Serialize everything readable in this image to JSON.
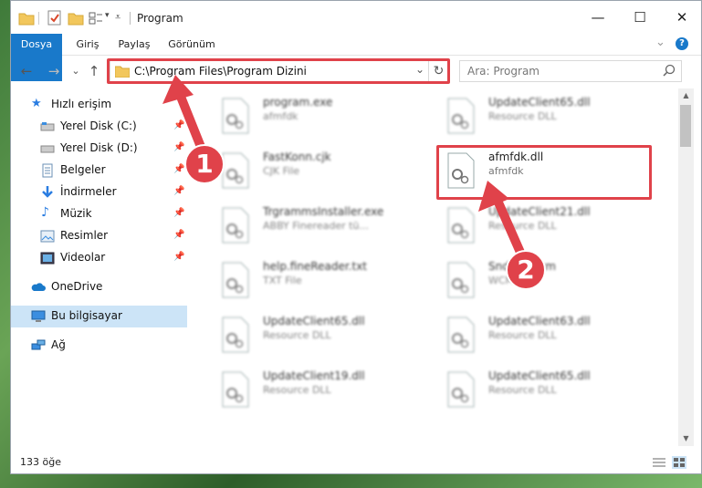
{
  "window": {
    "title": "Program",
    "controls": {
      "minimize": "—",
      "maximize": "☐",
      "close": "✕"
    }
  },
  "ribbon": {
    "tabs": [
      "Dosya",
      "Giriş",
      "Paylaş",
      "Görünüm"
    ],
    "collapse": "⌄",
    "help": "?"
  },
  "nav": {
    "back": "←",
    "forward": "→",
    "recent": "⌄",
    "up": "↑",
    "address": "C:\\Program Files\\Program Dizini",
    "address_dropdown": "⌄",
    "refresh": "↻",
    "search_placeholder": "Ara: Program"
  },
  "sidebar": {
    "items": [
      {
        "label": "Hızlı erişim",
        "icon": "star-icon"
      },
      {
        "label": "Yerel Disk (C:)",
        "icon": "drive-icon",
        "pinned": true
      },
      {
        "label": "Yerel Disk (D:)",
        "icon": "drive-icon",
        "pinned": true
      },
      {
        "label": "Belgeler",
        "icon": "documents-icon",
        "pinned": true
      },
      {
        "label": "İndirmeler",
        "icon": "download-icon",
        "pinned": true
      },
      {
        "label": "Müzik",
        "icon": "music-icon",
        "pinned": true
      },
      {
        "label": "Resimler",
        "icon": "pictures-icon",
        "pinned": true
      },
      {
        "label": "Videolar",
        "icon": "videos-icon",
        "pinned": true
      },
      {
        "label": "OneDrive",
        "icon": "cloud-icon"
      },
      {
        "label": "Bu bilgisayar",
        "icon": "computer-icon",
        "selected": true
      },
      {
        "label": "Ağ",
        "icon": "network-icon"
      }
    ],
    "pin_glyph": "📌"
  },
  "files": [
    {
      "name": "program.exe",
      "type": "afmfdk",
      "blurred": true
    },
    {
      "name": "UpdateClient65.dll",
      "type": "Resource DLL",
      "blurred": true
    },
    {
      "name": "FastKonn.cjk",
      "type": "CJK File",
      "blurred": true
    },
    {
      "name": "afmfdk.dll",
      "type": "afmfdk",
      "blurred": false
    },
    {
      "name": "TrgrammsInstaller.exe",
      "type": "ABBY Finereader tü...",
      "blurred": true
    },
    {
      "name": "UpdateClient21.dll",
      "type": "Resource DLL",
      "blurred": true
    },
    {
      "name": "help.fineReader.txt",
      "type": "TXT File",
      "blurred": true
    },
    {
      "name": "SndTxt.wcm",
      "type": "WCM File",
      "blurred": true
    },
    {
      "name": "UpdateClient65.dll",
      "type": "Resource DLL",
      "blurred": true
    },
    {
      "name": "UpdateClient63.dll",
      "type": "Resource DLL",
      "blurred": true
    },
    {
      "name": "UpdateClient19.dll",
      "type": "Resource DLL",
      "blurred": true
    },
    {
      "name": "UpdateClient65.dll",
      "type": "Resource DLL",
      "blurred": true
    }
  ],
  "status": {
    "count": "133 öğe"
  },
  "callouts": [
    "1",
    "2"
  ],
  "colors": {
    "accent": "#1979ca",
    "annotation": "#e0424a",
    "selected": "#cce4f7"
  }
}
